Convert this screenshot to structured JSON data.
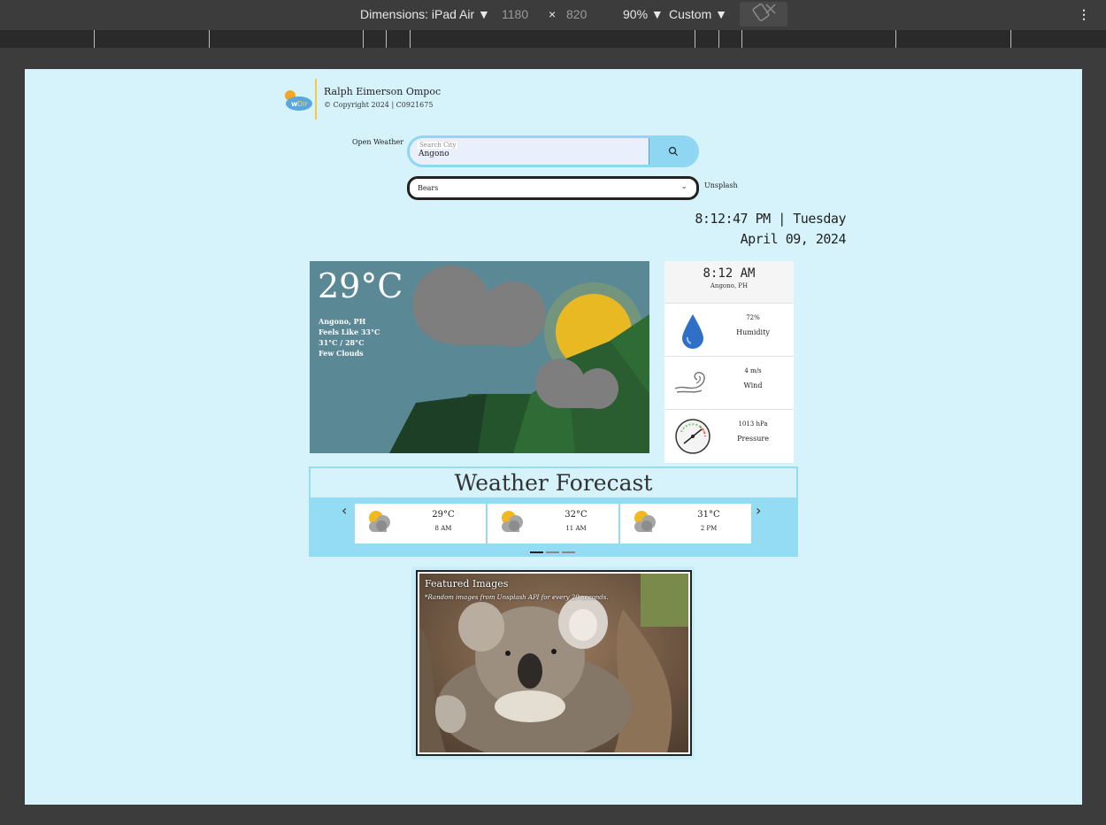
{
  "devtools": {
    "dimensions_label": "Dimensions: iPad Air ▼",
    "width": "1180",
    "times": "×",
    "height": "820",
    "zoom": "90% ▼",
    "throttle": "Custom ▼",
    "more": "⋮"
  },
  "header": {
    "author": "Ralph Eimerson Ompoc",
    "copyright": "© Copyright 2024 | C0921675"
  },
  "search": {
    "label": "Open Weather",
    "placeholder": "Search City",
    "value": "Angono"
  },
  "image_source": {
    "selected": "Bears",
    "label": "Unsplash"
  },
  "clock": {
    "time_day": "8:12:47 PM | Tuesday",
    "date": "April 09, 2024"
  },
  "current": {
    "temp": "29°C",
    "location": "Angono, PH",
    "feels_like": "Feels Like 33°C",
    "hi_lo": "31°C / 28°C",
    "condition": "Few Clouds",
    "colors": {
      "sky": "#5a8895",
      "sun": "#e8b923",
      "mountain": "#1f4a2a"
    }
  },
  "side": {
    "time": "8:12 AM",
    "location": "Angono, PH",
    "metrics": [
      {
        "value": "72%",
        "label": "Humidity",
        "icon": "water-drop-icon"
      },
      {
        "value": "4 m/s",
        "label": "Wind",
        "icon": "wind-icon"
      },
      {
        "value": "1013 hPa",
        "label": "Pressure",
        "icon": "pressure-gauge-icon"
      }
    ]
  },
  "forecast": {
    "title": "Weather Forecast",
    "items": [
      {
        "temp": "29°C",
        "time": "8 AM",
        "icon": "partly-cloudy-icon"
      },
      {
        "temp": "32°C",
        "time": "11 AM",
        "icon": "partly-cloudy-icon"
      },
      {
        "temp": "31°C",
        "time": "2 PM",
        "icon": "partly-cloudy-icon"
      }
    ],
    "prev": "‹",
    "next": "›",
    "active_page": 1,
    "pages": 3
  },
  "featured": {
    "title": "Featured Images",
    "subtitle": "*Random images from Unsplash API for every 20 seconds."
  }
}
